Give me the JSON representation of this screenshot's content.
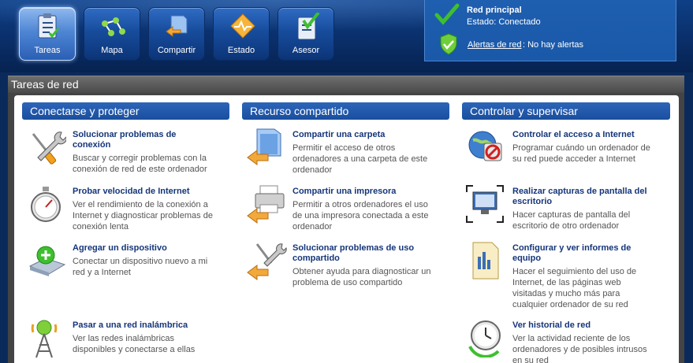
{
  "nav": {
    "items": [
      {
        "label": "Tareas",
        "icon": "tasks-clipboard-icon",
        "active": true
      },
      {
        "label": "Mapa",
        "icon": "network-map-icon",
        "active": false
      },
      {
        "label": "Compartir",
        "icon": "share-folder-icon",
        "active": false
      },
      {
        "label": "Estado",
        "icon": "status-pulse-icon",
        "active": false
      },
      {
        "label": "Asesor",
        "icon": "advisor-checklist-icon",
        "active": false
      }
    ]
  },
  "status": {
    "network_name": "Red principal",
    "network_status": "Estado: Conectado",
    "alerts_link": "Alertas de red",
    "alerts_text": ": No hay alertas",
    "colors": {
      "check": "#3fbf2f",
      "panel": "#1f5fb0"
    }
  },
  "section": {
    "title": "Tareas de red"
  },
  "columns": [
    {
      "title": "Conectarse y proteger",
      "tasks": [
        {
          "title": "Solucionar problemas de conexión",
          "desc": "Buscar y corregir problemas con la conexión de red de este ordenador",
          "icon": "tools-wrench-screwdriver-icon"
        },
        {
          "title": "Probar velocidad de Internet",
          "desc": "Ver el rendimiento de la conexión a Internet y diagnosticar problemas de conexión lenta",
          "icon": "stopwatch-icon"
        },
        {
          "title": "Agregar un dispositivo",
          "desc": "Conectar un dispositivo nuevo a mi red y a Internet",
          "icon": "add-device-icon"
        },
        {
          "title": "Pasar a una red inalámbrica",
          "desc": "Ver las redes inalámbricas disponibles y conectarse a ellas",
          "icon": "wireless-tower-icon"
        }
      ]
    },
    {
      "title": "Recurso compartido",
      "tasks": [
        {
          "title": "Compartir una carpeta",
          "desc": "Permitir el acceso de otros ordenadores a una carpeta de este ordenador",
          "icon": "share-folder-icon"
        },
        {
          "title": "Compartir una impresora",
          "desc": "Permitir a otros ordenadores el uso de una impresora conectada a este ordenador",
          "icon": "share-printer-icon"
        },
        {
          "title": "Solucionar problemas de uso compartido",
          "desc": "Obtener ayuda para diagnosticar un problema de uso compartido",
          "icon": "share-tools-icon"
        }
      ]
    },
    {
      "title": "Controlar y supervisar",
      "tasks": [
        {
          "title": "Controlar el acceso a Internet",
          "desc": "Programar cuándo un ordenador de su red puede acceder a Internet",
          "icon": "globe-blocked-icon"
        },
        {
          "title": "Realizar capturas de pantalla del escritorio",
          "desc": "Hacer capturas de pantalla del escritorio de otro ordenador",
          "icon": "screen-capture-icon"
        },
        {
          "title": "Configurar y ver informes de equipo",
          "desc": "Hacer el seguimiento del uso de Internet, de las páginas web visitadas y mucho más para cualquier ordenador de su red",
          "icon": "report-document-icon"
        },
        {
          "title": "Ver historial de red",
          "desc": "Ver la actividad reciente de los ordenadores y de posibles intrusos en su red",
          "icon": "history-clock-icon"
        }
      ]
    }
  ]
}
